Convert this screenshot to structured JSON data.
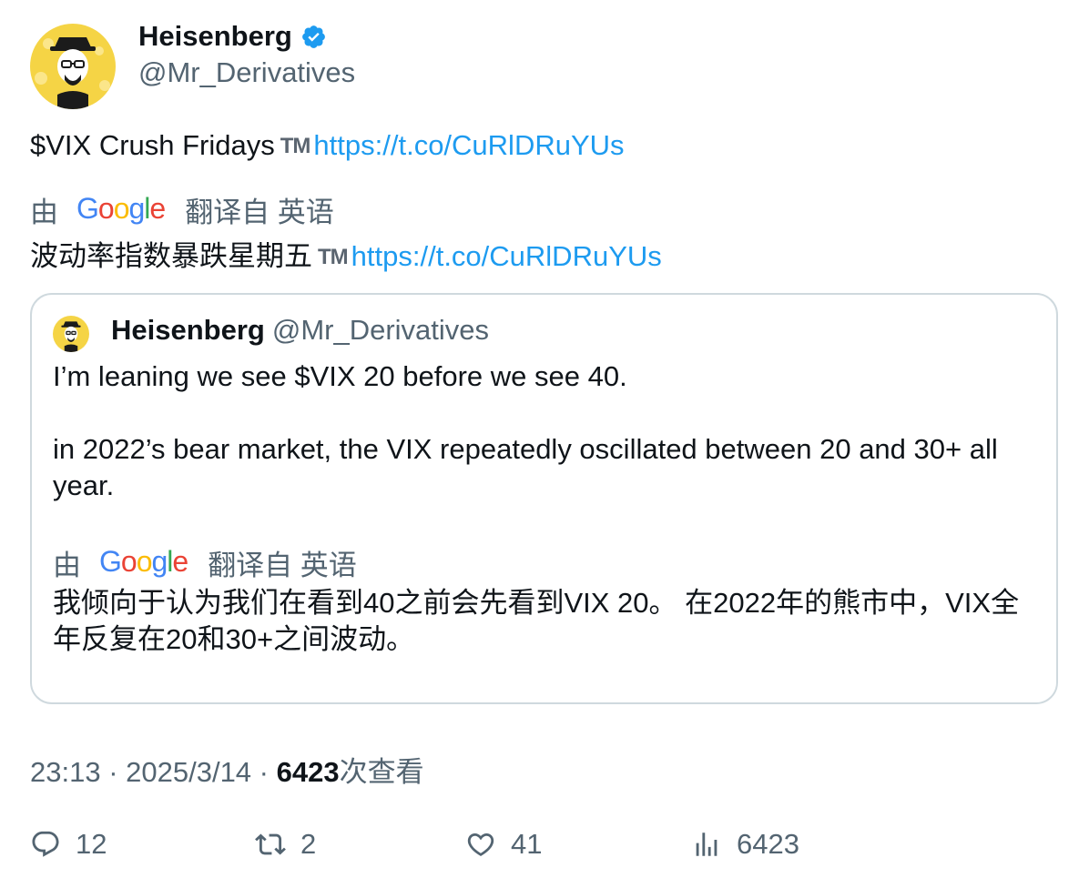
{
  "author": {
    "display_name": "Heisenberg",
    "handle": "@Mr_Derivatives",
    "avatar_icon": "heisenberg-avatar",
    "verified_icon": "verified-badge-icon"
  },
  "tweet": {
    "text": "$VIX Crush Fridays",
    "tm": "TM",
    "link": "https://t.co/CuRlDRuYUs"
  },
  "translation": {
    "by": "由",
    "google": "Google",
    "from": "翻译自 英语",
    "text": "波动率指数暴跌星期五",
    "tm": "TM",
    "link": "https://t.co/CuRlDRuYUs"
  },
  "quote": {
    "display_name": "Heisenberg",
    "handle": "@Mr_Derivatives",
    "line1": "I’m leaning we see $VIX 20 before we see 40.",
    "line2": "in 2022’s bear market, the VIX repeatedly oscillated between 20 and 30+ all year.",
    "translation_by": "由",
    "translation_google": "Google",
    "translation_from": "翻译自 英语",
    "translation_text": "我倾向于认为我们在看到40之前会先看到VIX 20。 在2022年的熊市中，VIX全年反复在20和30+之间波动。"
  },
  "meta": {
    "time": "23:13",
    "sep1": " · ",
    "date": "2025/3/14",
    "sep2": " · ",
    "views_count": "6423",
    "views_label": "次查看"
  },
  "actions": {
    "replies": "12",
    "retweets": "2",
    "likes": "41",
    "views": "6423"
  },
  "colors": {
    "link": "#1d9bf0",
    "secondary_text": "#536471",
    "verified": "#1d9bf0"
  }
}
